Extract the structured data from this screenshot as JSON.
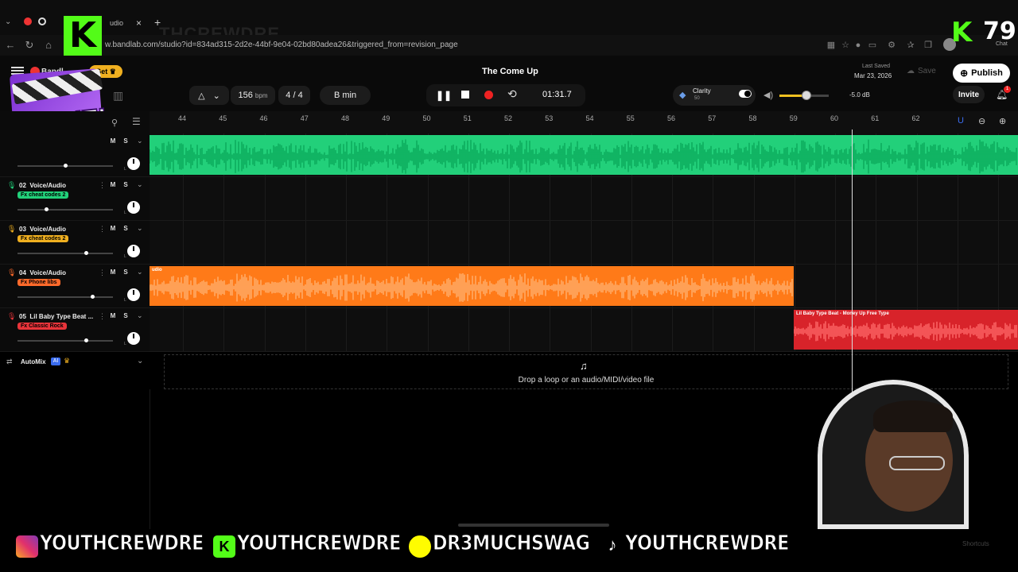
{
  "browser": {
    "url": "w.bandlab.com/studio?id=834ad315-2d2e-44bf-9e04-02bd80adea26&triggered_from=revision_page",
    "tab_title": "udio",
    "new_tab": "+",
    "close_tab": "×",
    "watermark": "THCREWDRE"
  },
  "stream_overlay": {
    "kick_viewers": "79",
    "chat_label": "Chat",
    "clip_it_text": "CLIP IT!",
    "handles": {
      "instagram": "YOUTHCREWDRE",
      "kick": "YOUTHCREWDRE",
      "snapchat": "DR3MUCHSWAG",
      "tiktok": "YOUTHCREWDRE"
    },
    "shortcuts": "Shortcuts"
  },
  "studio": {
    "brand": "Bandl",
    "get_badge": "Get",
    "project_title": "The Come Up",
    "last_saved_label": "Last Saved",
    "last_saved_date": "Mar 23, 2026",
    "save_label": "Save",
    "publish_label": "Publish",
    "invite_label": "Invite",
    "notification_count": "1",
    "tempo": "156",
    "tempo_unit": "bpm",
    "time_sig_num": "4",
    "time_sig_sep": "/",
    "time_sig_den": "4",
    "key": "B min",
    "time_display": "01:31.7",
    "clarity_label": "Clarity",
    "clarity_value": "50",
    "volume_db": "-5.0 dB",
    "volume_level": 0.55,
    "ruler_ticks": [
      "44",
      "45",
      "46",
      "47",
      "48",
      "49",
      "50",
      "51",
      "52",
      "53",
      "54",
      "55",
      "56",
      "57",
      "58",
      "59",
      "60",
      "61",
      "62"
    ],
    "playhead_bar": 60.4,
    "tracks": [
      {
        "num": "",
        "name": "",
        "fx": "",
        "fx_color": "#22d07a",
        "fader": 0.5
      },
      {
        "num": "02",
        "name": "Voice/Audio",
        "fx": "Fx cheat codes 2",
        "fx_color": "#22d07a",
        "fader": 0.3
      },
      {
        "num": "03",
        "name": "Voice/Audio",
        "fx": "Fx cheat codes 2",
        "fx_color": "#f0b020",
        "fader": 0.72
      },
      {
        "num": "04",
        "name": "Voice/Audio",
        "fx": "Fx Phone libs",
        "fx_color": "#ff6a2b",
        "fader": 0.78
      },
      {
        "num": "05",
        "name": "Lil Baby Type Beat ...",
        "fx": "Fx Classic Rock",
        "fx_color": "#e8343a",
        "fader": 0.72
      }
    ],
    "mute_label": "M",
    "solo_label": "S",
    "clip_orange_label": "udio",
    "clip_red_label": "Lil Baby Type Beat - Money Up  Free Type",
    "automix_label": "AutoMix",
    "ai_badge": "AI",
    "drop_text": "Drop a loop or an audio/MIDI/video file"
  },
  "colors": {
    "green": "#22d07a",
    "orange": "#ff7a18",
    "red": "#d8232a",
    "kick": "#53fc18"
  }
}
